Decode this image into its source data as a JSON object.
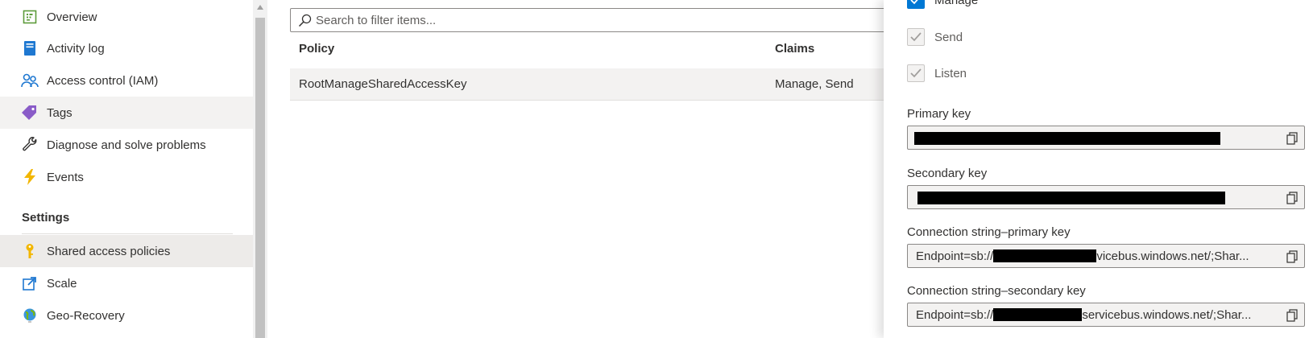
{
  "sidebar": {
    "items": [
      {
        "label": "Overview",
        "icon": "overview-icon"
      },
      {
        "label": "Activity log",
        "icon": "activity-log-icon"
      },
      {
        "label": "Access control (IAM)",
        "icon": "access-control-icon"
      },
      {
        "label": "Tags",
        "icon": "tag-icon"
      },
      {
        "label": "Diagnose and solve problems",
        "icon": "wrench-icon"
      },
      {
        "label": "Events",
        "icon": "lightning-icon"
      }
    ],
    "settings_heading": "Settings",
    "settings_items": [
      {
        "label": "Shared access policies",
        "icon": "key-icon"
      },
      {
        "label": "Scale",
        "icon": "scale-icon"
      },
      {
        "label": "Geo-Recovery",
        "icon": "globe-icon"
      }
    ]
  },
  "main": {
    "search_placeholder": "Search to filter items...",
    "columns": [
      "Policy",
      "Claims"
    ],
    "rows": [
      {
        "policy": "RootManageSharedAccessKey",
        "claims": "Manage, Send"
      }
    ]
  },
  "panel": {
    "checkboxes": [
      {
        "label": "Manage",
        "checked": true
      },
      {
        "label": "Send",
        "checked": true
      },
      {
        "label": "Listen",
        "checked": true
      }
    ],
    "fields": [
      {
        "label": "Primary key",
        "value": ""
      },
      {
        "label": "Secondary key",
        "value": ""
      },
      {
        "label": "Connection string–primary key",
        "value_prefix": "Endpoint=sb://",
        "value_suffix": "vicebus.windows.net/;Shar..."
      },
      {
        "label": "Connection string–secondary key",
        "value_prefix": "Endpoint=sb://",
        "value_suffix": "servicebus.windows.net/;Shar..."
      }
    ]
  },
  "colors": {
    "accent": "#0078d4",
    "selected_bg": "#edebe9",
    "row_bg": "#f3f2f1"
  }
}
